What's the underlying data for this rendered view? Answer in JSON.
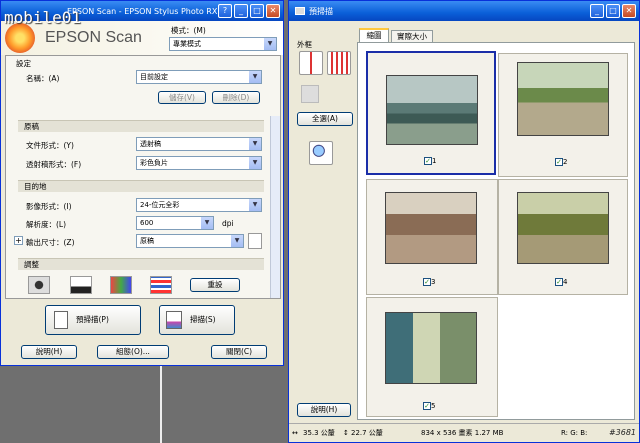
{
  "watermark": {
    "logo": "mobile01",
    "tag": "#3681"
  },
  "left_window": {
    "title": "EPSON Scan - EPSON Stylus Photo RX510",
    "brand": "EPSON Scan",
    "mode_label": "模式：(M)",
    "mode_value": "專業模式",
    "settings_header": "設定",
    "name_label": "名稱：(A)",
    "name_value": "目前設定",
    "save_label": "儲存(V)",
    "delete_label": "刪除(D)",
    "original_header": "原稿",
    "doc_type_label": "文件形式：(Y)",
    "doc_type_value": "透射稿",
    "film_type_label": "透射稿形式：(F)",
    "film_type_value": "彩色負片",
    "dest_header": "目的地",
    "image_type_label": "影像形式：(I)",
    "image_type_value": "24-位元全彩",
    "resolution_label": "解析度：(L)",
    "resolution_value": "600",
    "resolution_unit": "dpi",
    "output_size_label": "輸出尺寸：(Z)",
    "output_size_value": "原稿",
    "adjust_header": "調整",
    "reset_label": "重設",
    "preview_label": "預掃描(P)",
    "scan_label": "掃描(S)",
    "help_label": "說明(H)",
    "config_label": "組態(O)...",
    "close_label": "關閉(C)"
  },
  "right_window": {
    "title": "預掃描",
    "frame_label": "外框",
    "tab_thumb": "縮圖",
    "tab_actual": "實際大小",
    "select_all": "全選(A)",
    "help_label": "說明(H)",
    "status_width": "35.3 公釐",
    "status_height": "22.7 公釐",
    "status_pixels": "834 x 536 畫素 1.27 MB",
    "status_rgb": "R: G: B:",
    "thumbnails": [
      {
        "label": "1",
        "checked": true,
        "selected": true
      },
      {
        "label": "2",
        "checked": true,
        "selected": false
      },
      {
        "label": "3",
        "checked": true,
        "selected": false
      },
      {
        "label": "4",
        "checked": true,
        "selected": false
      },
      {
        "label": "5",
        "checked": true,
        "selected": false
      }
    ]
  }
}
